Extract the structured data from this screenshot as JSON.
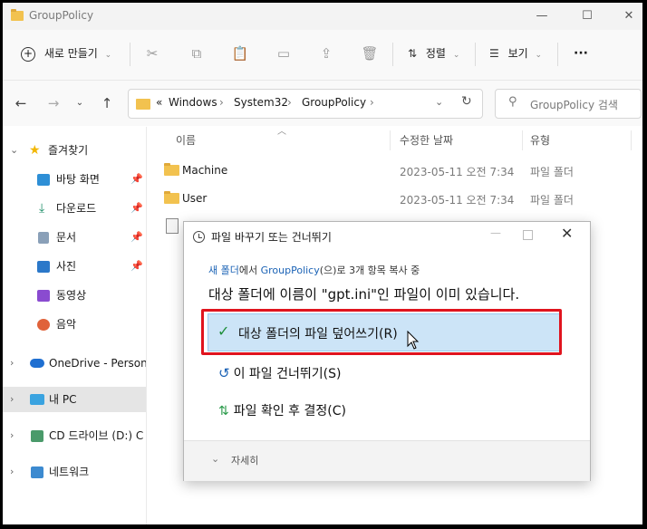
{
  "window": {
    "title": "GroupPolicy",
    "minimize": "—",
    "maximize": "☐",
    "close": "✕"
  },
  "toolbar": {
    "new_label": "새로 만들기",
    "sort_label": "정렬",
    "view_label": "보기",
    "more_label": "···"
  },
  "address": {
    "overflow": "«",
    "crumbs": [
      "Windows",
      "System32",
      "GroupPolicy"
    ],
    "search_placeholder": "GroupPolicy 검색"
  },
  "sidebar": {
    "items": [
      {
        "label": "즐겨찾기",
        "icon": "star-icon"
      },
      {
        "label": "바탕 화면",
        "icon": "desktop-icon"
      },
      {
        "label": "다운로드",
        "icon": "download-icon"
      },
      {
        "label": "문서",
        "icon": "document-icon"
      },
      {
        "label": "사진",
        "icon": "pictures-icon"
      },
      {
        "label": "동영상",
        "icon": "video-icon"
      },
      {
        "label": "음악",
        "icon": "music-icon"
      },
      {
        "label": "OneDrive - Persona",
        "icon": "cloud-icon"
      },
      {
        "label": "내 PC",
        "icon": "pc-icon"
      },
      {
        "label": "CD 드라이브 (D:) C",
        "icon": "cd-drive-icon"
      },
      {
        "label": "네트워크",
        "icon": "network-icon"
      }
    ]
  },
  "columns": {
    "name": "이름",
    "modified": "수정한 날짜",
    "type": "유형"
  },
  "files": [
    {
      "name": "Machine",
      "modified": "2023-05-11 오전 7:34",
      "type": "파일 폴더"
    },
    {
      "name": "User",
      "modified": "2023-05-11 오전 7:34",
      "type": "파일 폴더"
    }
  ],
  "dialog": {
    "title": "파일 바꾸기 또는 건너뛰기",
    "subtitle_src": "새 폴더",
    "subtitle_mid": "에서 ",
    "subtitle_dst": "GroupPolicy",
    "subtitle_end": "(으)로 3개 항목 복사 중",
    "message": "대상 폴더에 이름이 \"gpt.ini\"인 파일이 이미 있습니다.",
    "option_replace": "대상 폴더의 파일 덮어쓰기(R)",
    "option_skip": "이 파일 건너뛰기(S)",
    "option_decide": "파일 확인 후 결정(C)",
    "details": "자세히"
  },
  "colors": {
    "highlight": "#cce4f7",
    "callout": "#e0141e",
    "link": "#1a62b5"
  }
}
